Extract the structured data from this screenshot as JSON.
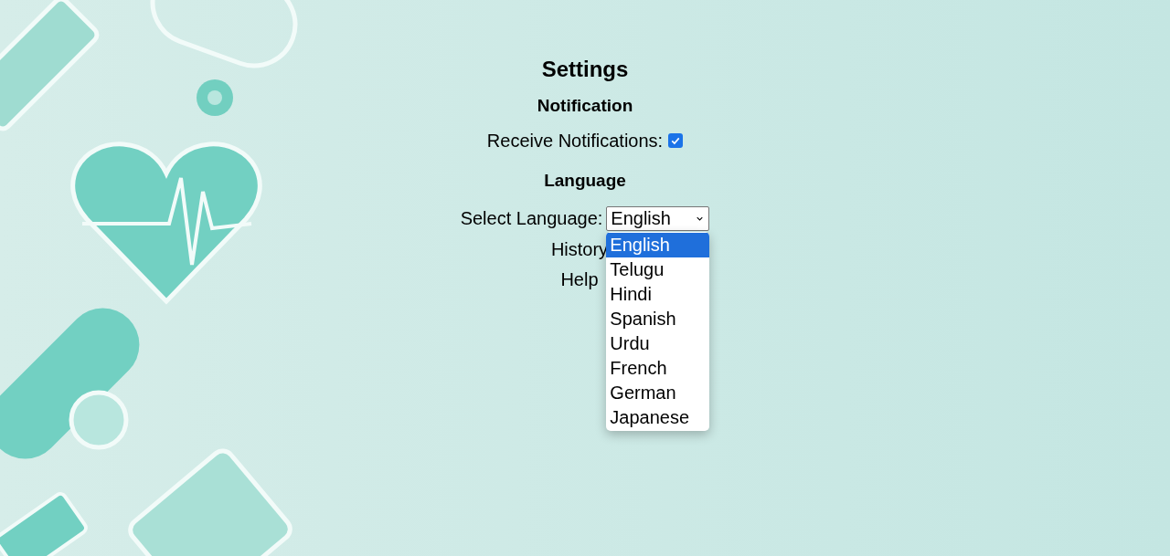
{
  "title": "Settings",
  "notification": {
    "heading": "Notification",
    "label": "Receive Notifications:",
    "checked": true
  },
  "language": {
    "heading": "Language",
    "label": "Select Language:",
    "value": "English",
    "options": [
      {
        "label": "English",
        "selected": true
      },
      {
        "label": "Telugu",
        "selected": false
      },
      {
        "label": "Hindi",
        "selected": false
      },
      {
        "label": "Spanish",
        "selected": false
      },
      {
        "label": "Urdu",
        "selected": false
      },
      {
        "label": "French",
        "selected": false
      },
      {
        "label": "German",
        "selected": false
      },
      {
        "label": "Japanese",
        "selected": false
      }
    ]
  },
  "links": [
    "History",
    "Help"
  ]
}
